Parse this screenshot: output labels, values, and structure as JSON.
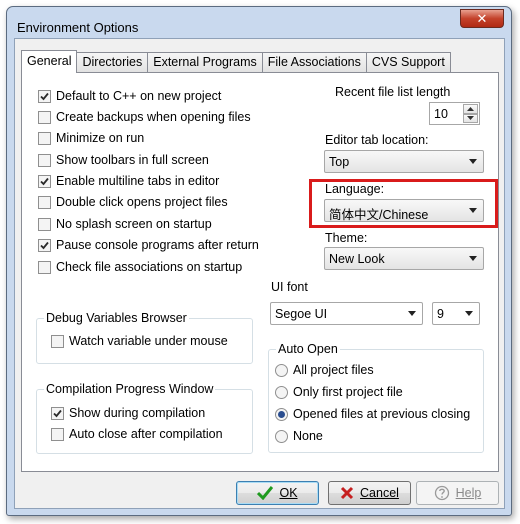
{
  "window": {
    "title": "Environment Options",
    "close_glyph": "✕"
  },
  "tabs": [
    {
      "label": "General",
      "active": true
    },
    {
      "label": "Directories",
      "active": false
    },
    {
      "label": "External Programs",
      "active": false
    },
    {
      "label": "File Associations",
      "active": false
    },
    {
      "label": "CVS Support",
      "active": false
    }
  ],
  "general": {
    "options": [
      {
        "label": "Default to C++ on new project",
        "checked": true
      },
      {
        "label": "Create backups when opening files",
        "checked": false
      },
      {
        "label": "Minimize on run",
        "checked": false
      },
      {
        "label": "Show toolbars in full screen",
        "checked": false
      },
      {
        "label": "Enable multiline tabs in editor",
        "checked": true
      },
      {
        "label": "Double click opens project files",
        "checked": false
      },
      {
        "label": "No splash screen on startup",
        "checked": false
      },
      {
        "label": "Pause console programs after return",
        "checked": true
      },
      {
        "label": "Check file associations on startup",
        "checked": false
      }
    ],
    "recent_files": {
      "label": "Recent file list length",
      "value": "10"
    },
    "tab_location": {
      "label": "Editor tab location:",
      "value": "Top"
    },
    "language": {
      "label": "Language:",
      "value": "简体中文/Chinese",
      "highlight_color": "#d91b1b"
    },
    "theme": {
      "label": "Theme:",
      "value": "New Look"
    },
    "ui_font": {
      "label": "UI font",
      "family": "Segoe UI",
      "size": "9"
    },
    "debug_group": {
      "legend": "Debug Variables Browser",
      "watch": {
        "label": "Watch variable under mouse",
        "checked": false
      }
    },
    "compile_group": {
      "legend": "Compilation Progress Window",
      "show": {
        "label": "Show during compilation",
        "checked": true
      },
      "autoclose": {
        "label": "Auto close after compilation",
        "checked": false
      }
    },
    "auto_open": {
      "legend": "Auto Open",
      "options": [
        {
          "label": "All project files",
          "selected": false
        },
        {
          "label": "Only first project file",
          "selected": false
        },
        {
          "label": "Opened files at previous closing",
          "selected": true
        },
        {
          "label": "None",
          "selected": false
        }
      ]
    }
  },
  "buttons": {
    "ok": {
      "label": "OK",
      "icon": "checkmark-icon",
      "icon_color": "#1f9a1f"
    },
    "cancel": {
      "label": "Cancel",
      "icon": "x-icon",
      "icon_color": "#c62020"
    },
    "help": {
      "label": "Help",
      "icon": "help-icon",
      "enabled": false
    }
  }
}
